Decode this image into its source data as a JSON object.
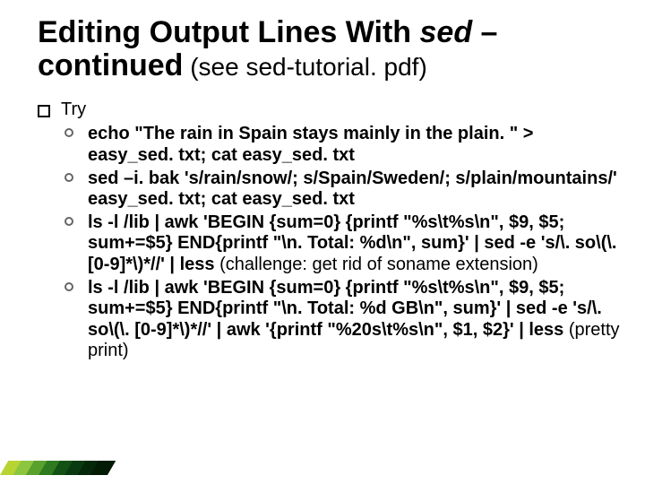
{
  "title": {
    "part1": "Editing Output Lines With ",
    "sed": "sed",
    "dash": " – ",
    "part2": "continued",
    "sub": " (see sed-tutorial. pdf)"
  },
  "try_label": "Try",
  "items": [
    {
      "cmd": "echo \"The rain in Spain stays mainly in the plain. \" > easy_sed. txt; cat easy_sed. txt",
      "note": ""
    },
    {
      "cmd": "sed –i. bak 's/rain/snow/; s/Spain/Sweden/; s/plain/mountains/' easy_sed. txt; cat easy_sed. txt",
      "note": ""
    },
    {
      "cmd": "ls -l /lib | awk 'BEGIN {sum=0} {printf \"%s\\t%s\\n\", $9, $5; sum+=$5} END{printf  \"\\n. Total: %d\\n\", sum}' | sed -e 's/\\. so\\(\\. [0-9]*\\)*//'  | less",
      "note": " (challenge: get rid of soname extension)"
    },
    {
      "cmd": "ls -l /lib | awk 'BEGIN {sum=0} {printf \"%s\\t%s\\n\", $9, $5; sum+=$5} END{printf  \"\\n. Total: %d GB\\n\", sum}' | sed -e 's/\\. so\\(\\. [0-9]*\\)*//' | awk '{printf  \"%20s\\t%s\\n\", $1, $2}'  | less",
      "note": " (pretty print)"
    }
  ]
}
